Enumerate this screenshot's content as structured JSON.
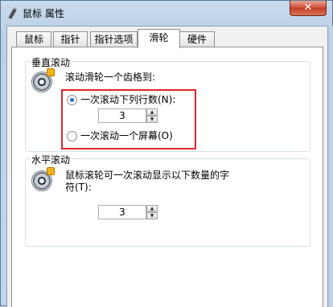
{
  "window": {
    "title": "鼠标 属性",
    "close_label": "✕"
  },
  "tabs": [
    {
      "label": "鼠标键",
      "active": false
    },
    {
      "label": "指针",
      "active": false
    },
    {
      "label": "指针选项",
      "active": false
    },
    {
      "label": "滑轮",
      "active": true
    },
    {
      "label": "硬件",
      "active": false
    }
  ],
  "vertical_scroll": {
    "title": "垂直滚动",
    "prompt": "滚动滑轮一个齿格到:",
    "option_lines": "一次滚动下列行数(N):",
    "lines_value": "3",
    "option_screen": "一次滚动一个屏幕(O)",
    "selected": "lines"
  },
  "horizontal_scroll": {
    "title": "水平滚动",
    "prompt_line1": "鼠标滚轮可一次滚动显示以下数量的字",
    "prompt_line2": "符(T):",
    "chars_value": "3"
  },
  "colors": {
    "highlight": "#e0252b",
    "radio_selected": "#2b6fc2"
  }
}
